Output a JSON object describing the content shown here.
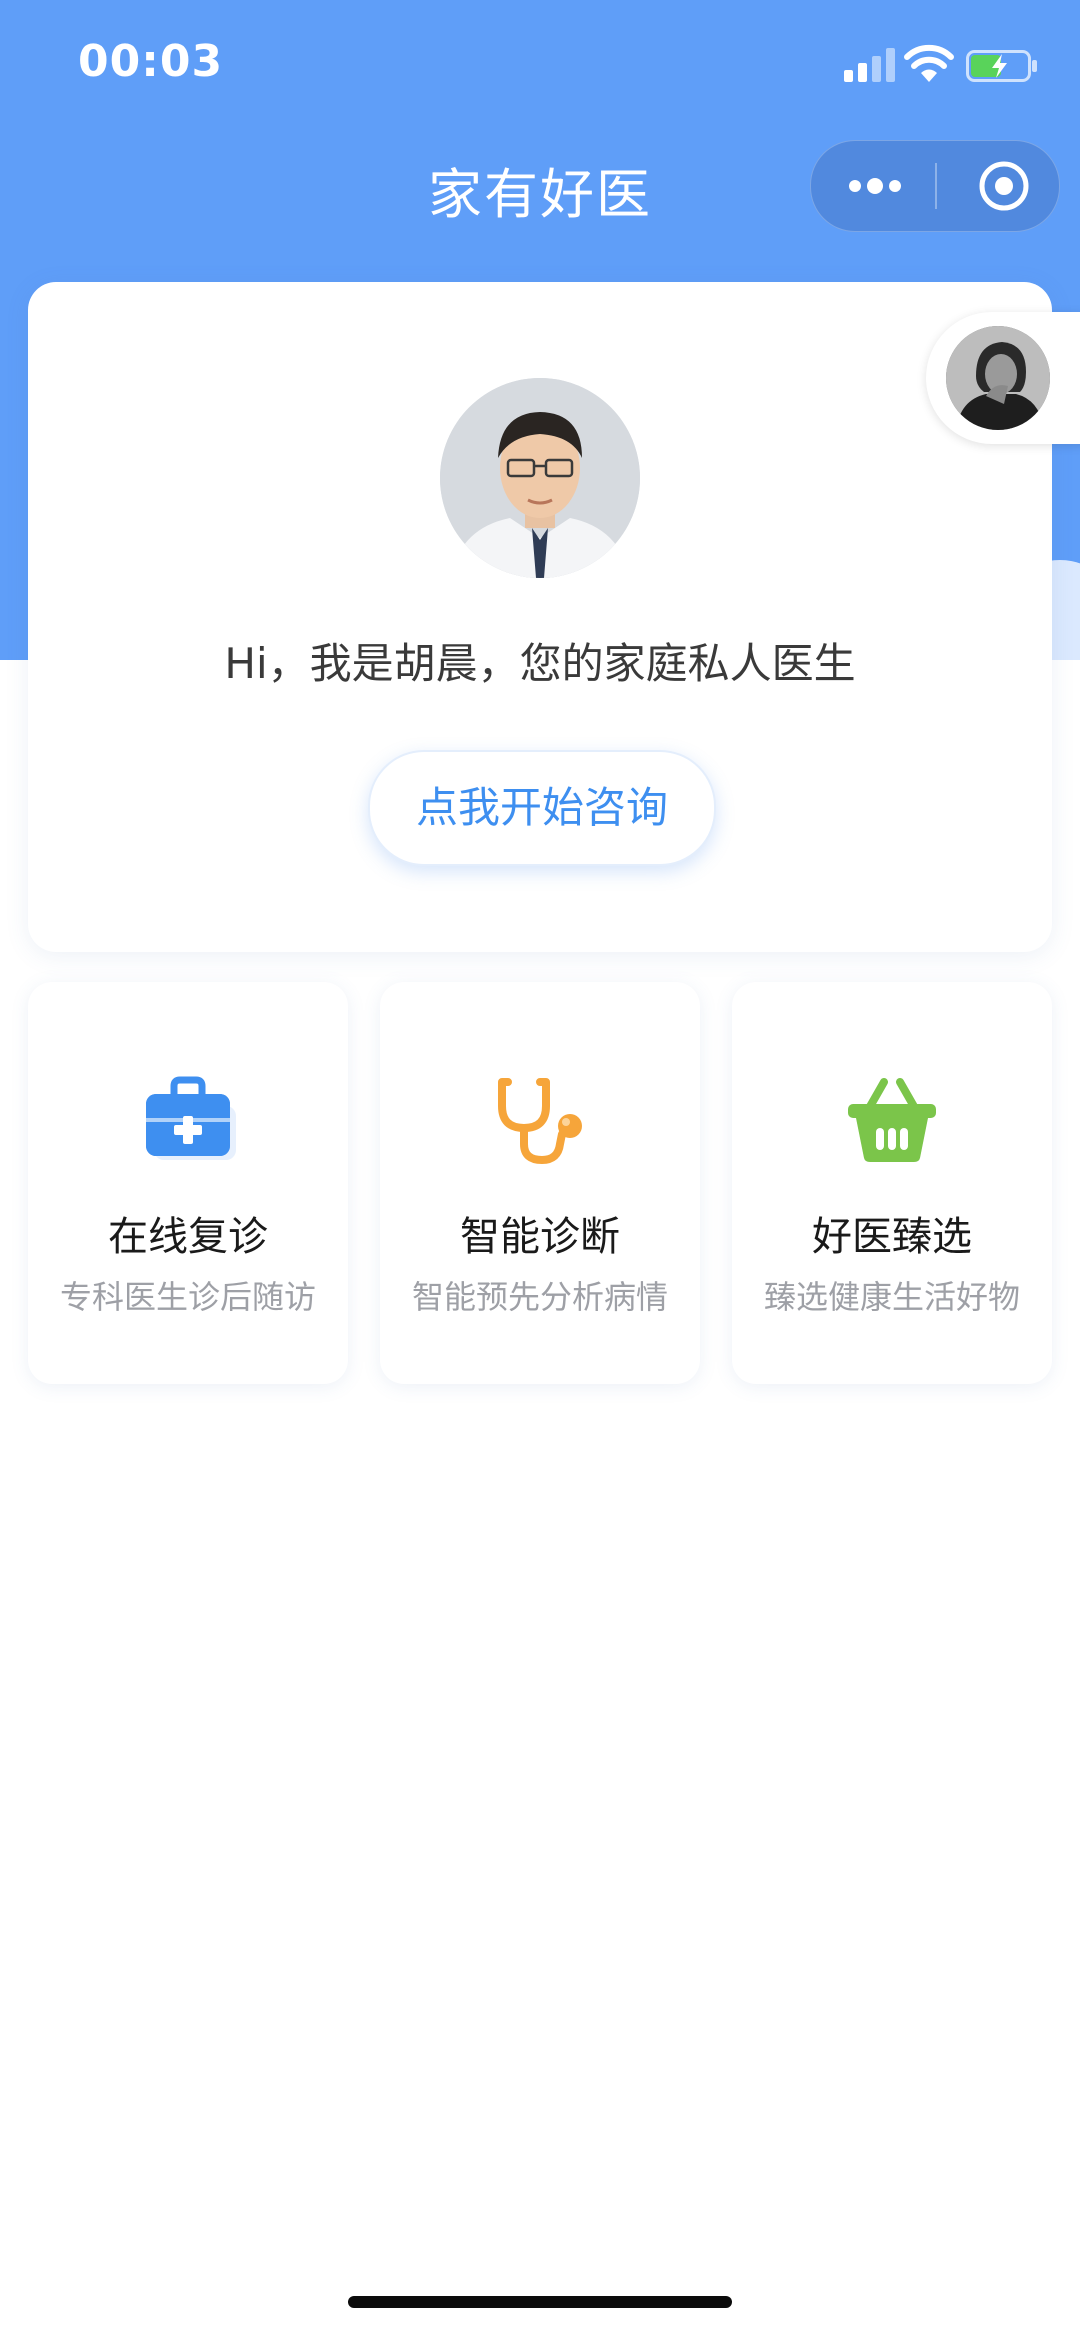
{
  "status_bar": {
    "time": "00:03"
  },
  "nav": {
    "title": "家有好医"
  },
  "profile": {
    "greeting": "Hi，我是胡晨，您的家庭私人医生",
    "consult_button": "点我开始咨询"
  },
  "services": [
    {
      "title": "在线复诊",
      "desc": "专科医生诊后随访",
      "icon": "medical-kit-icon",
      "color": "#3e8ff0"
    },
    {
      "title": "智能诊断",
      "desc": "智能预先分析病情",
      "icon": "stethoscope-icon",
      "color": "#f6a53a"
    },
    {
      "title": "好医臻选",
      "desc": "臻选健康生活好物",
      "icon": "shopping-basket-icon",
      "color": "#7bc54a"
    }
  ]
}
